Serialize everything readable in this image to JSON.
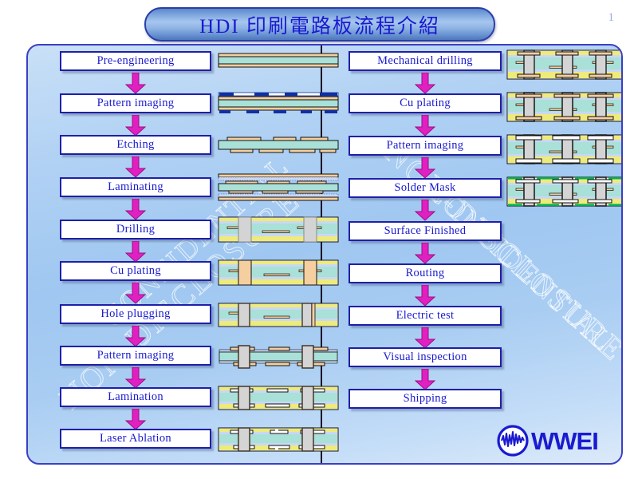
{
  "slide": {
    "title": "HDI 印刷電路板流程介紹",
    "page_number": "1",
    "watermark_lines": [
      "NON-DISCLOSURE",
      "CONFIDENTIAL",
      "NON-DISCLOSURE",
      "CONFIDENTIAL"
    ],
    "colors": {
      "title_text": "#1a1ad0",
      "box_border": "#1f1fa8",
      "box_fill": "#ffffff",
      "arrow": "#e020c0",
      "panel_border": "#3b3fc4",
      "panel_bg": "#a9cdf2",
      "logo": "#1a1ad0",
      "solder_mask_green": "#00b050",
      "copper_tan": "#f5cfa0",
      "core_teal": "#a9e0d8"
    }
  },
  "flow": {
    "left_column": [
      {
        "label": "Pre-engineering",
        "diagram": "laminate-base"
      },
      {
        "label": "Pattern imaging",
        "diagram": "resist-patterned"
      },
      {
        "label": "Etching",
        "diagram": "etched-traces"
      },
      {
        "label": "Laminating",
        "diagram": "prepreg-stack"
      },
      {
        "label": "Drilling",
        "diagram": "drilled-holes"
      },
      {
        "label": "Cu plating",
        "diagram": "plated-vias"
      },
      {
        "label": "Hole plugging",
        "diagram": "plugged-vias"
      },
      {
        "label": "Pattern imaging",
        "diagram": "inner-imaging"
      },
      {
        "label": "Lamination",
        "diagram": "outer-lamination"
      },
      {
        "label": "Laser Ablation",
        "diagram": "laser-microvia"
      }
    ],
    "right_column": [
      {
        "label": "Mechanical drilling",
        "diagram": "mech-drilled"
      },
      {
        "label": "Cu plating",
        "diagram": "through-plated"
      },
      {
        "label": "Pattern imaging",
        "diagram": "outer-imaging"
      },
      {
        "label": "Solder Mask",
        "diagram": "solder-mask"
      },
      {
        "label": "Surface Finished",
        "diagram": ""
      },
      {
        "label": "Routing",
        "diagram": ""
      },
      {
        "label": "Electric test",
        "diagram": ""
      },
      {
        "label": "Visual inspection",
        "diagram": ""
      },
      {
        "label": "Shipping",
        "diagram": ""
      }
    ]
  },
  "logo": {
    "text": "WWEI",
    "mark": "waveform-circle-icon"
  }
}
